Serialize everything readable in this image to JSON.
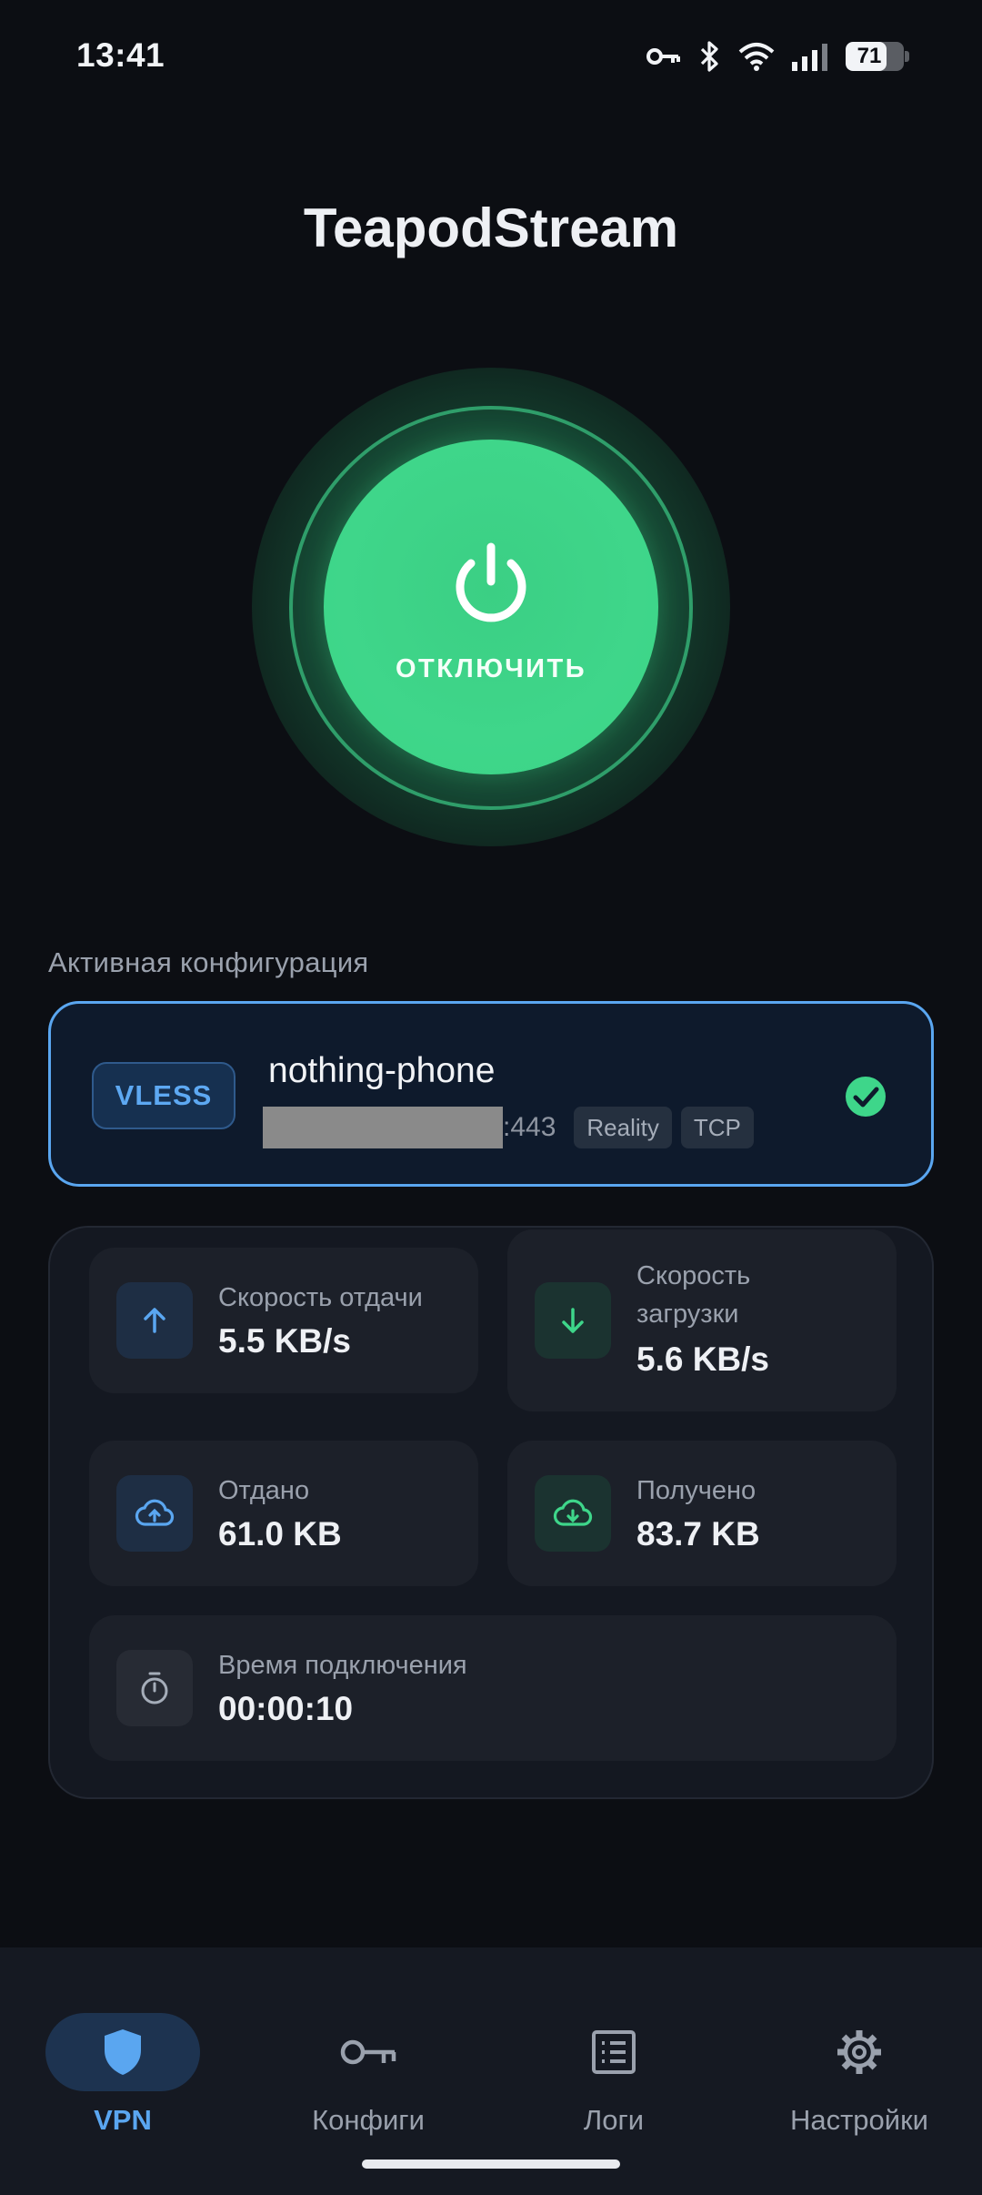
{
  "status_bar": {
    "time": "13:41",
    "battery_level": "71",
    "icons": [
      "vpn-key-icon",
      "bluetooth-icon",
      "wifi-icon",
      "signal-icon",
      "battery-icon"
    ]
  },
  "app": {
    "title": "TeapodStream"
  },
  "power": {
    "label": "ОТКЛЮЧИТЬ",
    "state": "connected",
    "accent": "#3ed68a"
  },
  "active_config": {
    "section_label": "Активная конфигурация",
    "protocol": "VLESS",
    "name": "nothing-phone",
    "port": ":443",
    "tags": [
      "Reality",
      "TCP"
    ],
    "selected": true
  },
  "stats": {
    "upload_speed": {
      "label": "Скорость отдачи",
      "value": "5.5 KB/s"
    },
    "download_speed": {
      "label": "Скорость загрузки",
      "value": "5.6 KB/s"
    },
    "sent": {
      "label": "Отдано",
      "value": "61.0 KB"
    },
    "received": {
      "label": "Получено",
      "value": "83.7 KB"
    },
    "connection_time": {
      "label": "Время подключения",
      "value": "00:00:10"
    }
  },
  "nav": {
    "items": [
      {
        "label": "VPN",
        "icon": "shield-icon",
        "active": true
      },
      {
        "label": "Конфиги",
        "icon": "key-icon",
        "active": false
      },
      {
        "label": "Логи",
        "icon": "list-icon",
        "active": false
      },
      {
        "label": "Настройки",
        "icon": "gear-icon",
        "active": false
      }
    ]
  },
  "colors": {
    "background": "#0c0e13",
    "accent_blue": "#5aa6f0",
    "accent_green": "#3ed68a"
  }
}
